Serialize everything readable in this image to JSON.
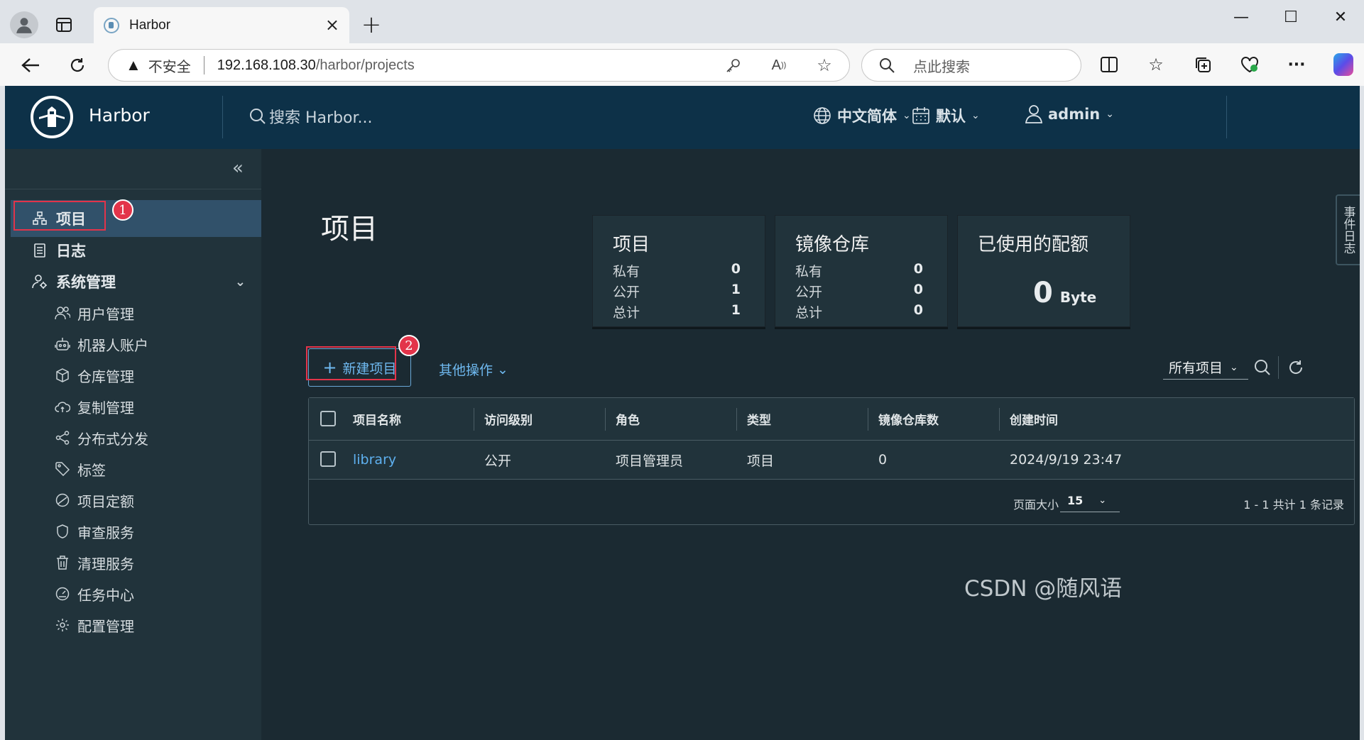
{
  "browser": {
    "tab_title": "Harbor",
    "url_warning": "不安全",
    "url_host": "192.168.108.30",
    "url_path": "/harbor/projects",
    "search_placeholder": "点此搜索"
  },
  "header": {
    "brand": "Harbor",
    "search_placeholder": "搜索 Harbor...",
    "language": "中文简体",
    "theme": "默认",
    "user": "admin"
  },
  "sidebar": {
    "items": [
      {
        "label": "项目"
      },
      {
        "label": "日志"
      },
      {
        "label": "系统管理"
      }
    ],
    "admin_items": [
      {
        "label": "用户管理"
      },
      {
        "label": "机器人账户"
      },
      {
        "label": "仓库管理"
      },
      {
        "label": "复制管理"
      },
      {
        "label": "分布式分发"
      },
      {
        "label": "标签"
      },
      {
        "label": "项目定额"
      },
      {
        "label": "审查服务"
      },
      {
        "label": "清理服务"
      },
      {
        "label": "任务中心"
      },
      {
        "label": "配置管理"
      }
    ]
  },
  "annotations": {
    "badge1": "1",
    "badge2": "2"
  },
  "main": {
    "title": "项目",
    "cards": {
      "projects": {
        "title": "项目",
        "rows": [
          {
            "label": "私有",
            "value": "0"
          },
          {
            "label": "公开",
            "value": "1"
          },
          {
            "label": "总计",
            "value": "1"
          }
        ]
      },
      "repos": {
        "title": "镜像仓库",
        "rows": [
          {
            "label": "私有",
            "value": "0"
          },
          {
            "label": "公开",
            "value": "0"
          },
          {
            "label": "总计",
            "value": "0"
          }
        ]
      },
      "quota": {
        "title": "已使用的配额",
        "value": "0",
        "unit": "Byte"
      }
    },
    "new_project": "新建项目",
    "other_actions": "其他操作",
    "filter": "所有项目",
    "table": {
      "headers": [
        "项目名称",
        "访问级别",
        "角色",
        "类型",
        "镜像仓库数",
        "创建时间"
      ],
      "rows": [
        {
          "name": "library",
          "access": "公开",
          "role": "项目管理员",
          "type": "项目",
          "repo_count": "0",
          "created": "2024/9/19 23:47"
        }
      ],
      "page_size_label": "页面大小",
      "page_size": "15",
      "page_info": "1 - 1 共计 1 条记录"
    },
    "event_log": "事件日志"
  },
  "watermark": "CSDN @随风语"
}
